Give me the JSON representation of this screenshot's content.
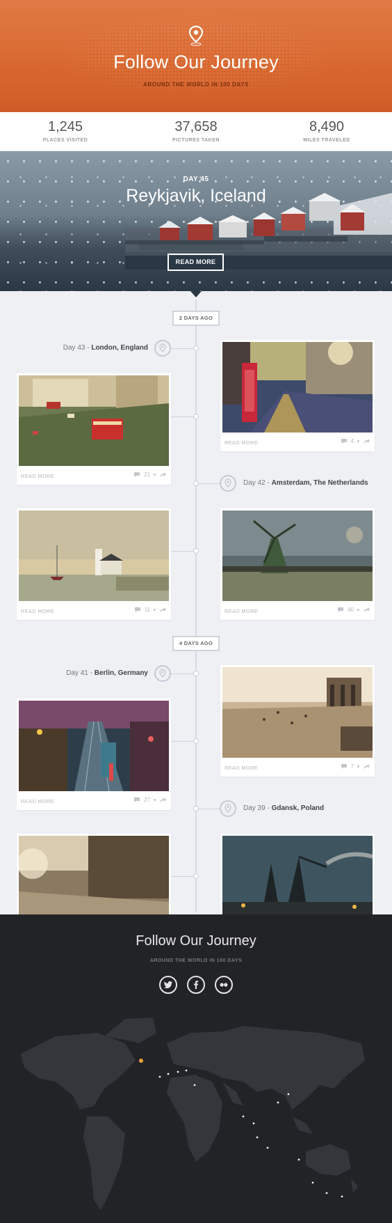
{
  "hero": {
    "title": "Follow Our Journey",
    "subtitle": "AROUND THE WORLD IN 100 DAYS",
    "icon": "location-pin-icon"
  },
  "stats": [
    {
      "value": "1,245",
      "label": "PLACES VISITED"
    },
    {
      "value": "37,658",
      "label": "PICTURES TAKEN"
    },
    {
      "value": "8,490",
      "label": "MILES TRAVELED"
    }
  ],
  "feature": {
    "day": "DAY 45",
    "city": "Reykjavik, Iceland",
    "button": "READ MORE"
  },
  "timeline": {
    "badges": [
      "2 DAYS AGO",
      "4 DAYS AGO"
    ],
    "locations": [
      {
        "day": "Day 43 - ",
        "place": "London, England"
      },
      {
        "day": "Day 42 - ",
        "place": "Amsterdam, The Netherlands"
      },
      {
        "day": "Day 41 - ",
        "place": "Berlin, Germany"
      },
      {
        "day": "Day 39 - ",
        "place": "Gdansk, Poland"
      }
    ],
    "cards": [
      {
        "read_more": "READ MORE",
        "comments": "21"
      },
      {
        "read_more": "READ MORE",
        "comments": "4"
      },
      {
        "read_more": "READ MORE",
        "comments": "11"
      },
      {
        "read_more": "READ MORE",
        "comments": "40"
      },
      {
        "read_more": "READ MORE",
        "comments": "27"
      },
      {
        "read_more": "READ MORE",
        "comments": "7"
      }
    ]
  },
  "footer": {
    "title": "Follow Our Journey",
    "subtitle": "AROUND THE WORLD IN 100 DAYS",
    "social": [
      "twitter-icon",
      "facebook-icon",
      "flickr-icon"
    ]
  },
  "colors": {
    "hero": "#d8672f",
    "footer": "#222327",
    "timeline_bg": "#eef0f4"
  }
}
